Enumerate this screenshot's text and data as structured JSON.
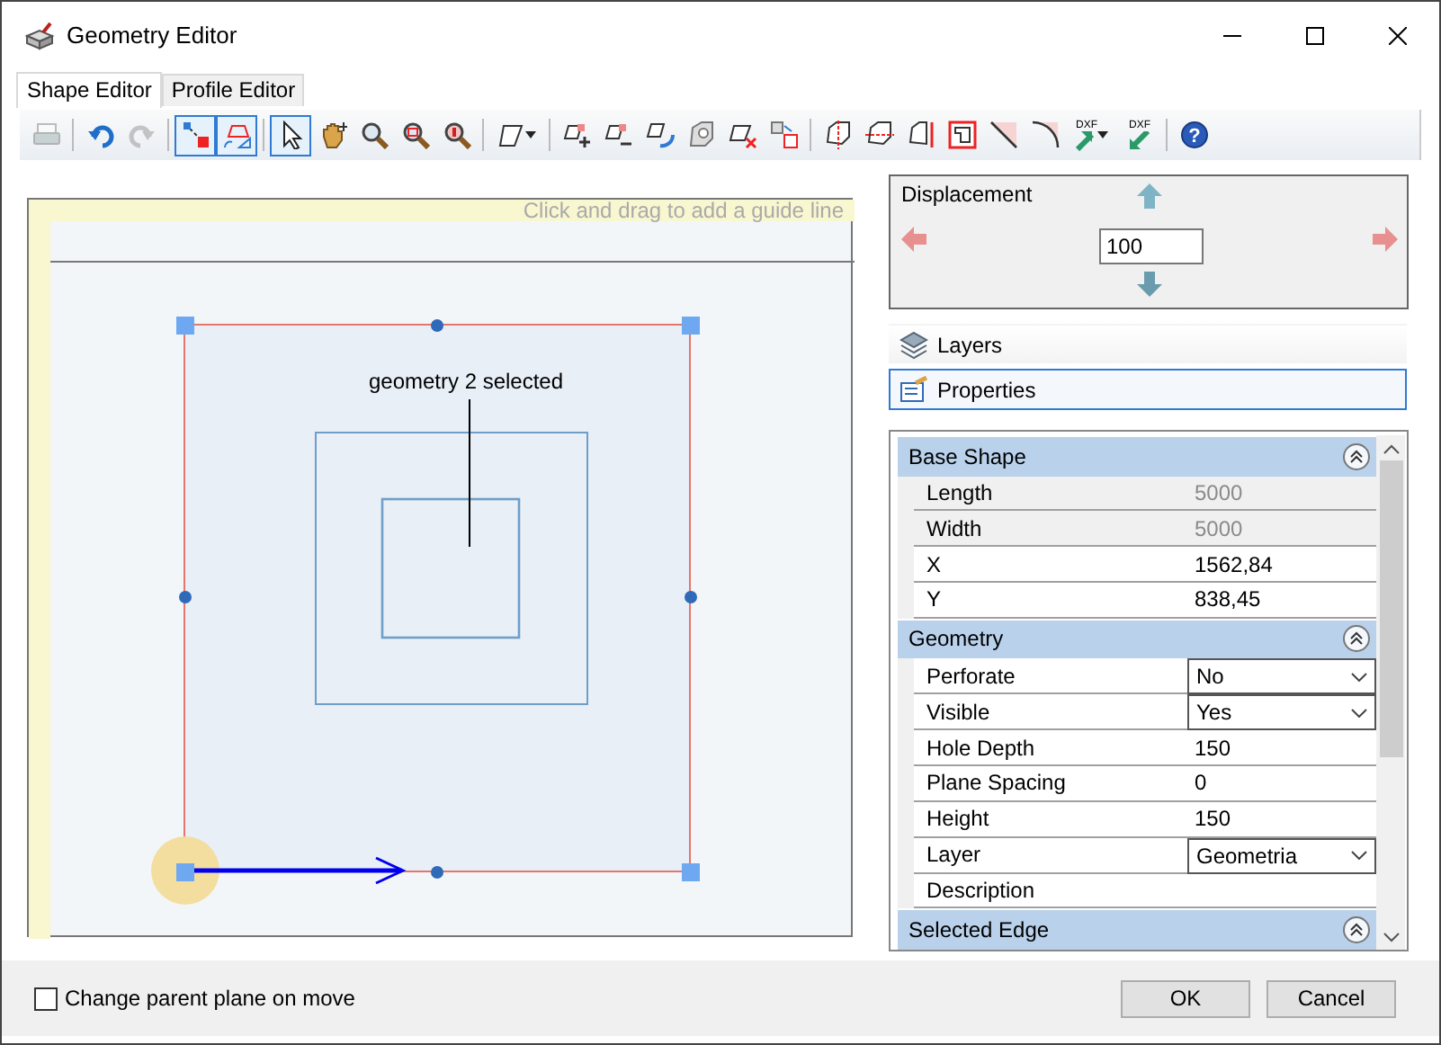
{
  "window": {
    "title": "Geometry Editor"
  },
  "tabs": [
    {
      "label": "Shape Editor",
      "selected": true
    },
    {
      "label": "Profile Editor",
      "selected": false
    }
  ],
  "toolbar": [
    [
      {
        "kind": "print",
        "selected": false,
        "disabled": true,
        "dropdown": false
      }
    ],
    [
      {
        "kind": "undo",
        "selected": false,
        "disabled": false,
        "dropdown": false
      },
      {
        "kind": "redo",
        "selected": false,
        "disabled": true,
        "dropdown": false
      }
    ],
    [
      {
        "kind": "node-edit",
        "selected": true,
        "disabled": false,
        "dropdown": false
      },
      {
        "kind": "shape-edit",
        "selected": true,
        "disabled": false,
        "dropdown": false
      }
    ],
    [
      {
        "kind": "pointer",
        "selected": true,
        "disabled": false,
        "dropdown": false
      },
      {
        "kind": "pan",
        "selected": false,
        "disabled": false,
        "dropdown": false
      },
      {
        "kind": "zoom",
        "selected": false,
        "disabled": false,
        "dropdown": false
      },
      {
        "kind": "zoom-box",
        "selected": false,
        "disabled": false,
        "dropdown": false
      },
      {
        "kind": "zoom-fit",
        "selected": false,
        "disabled": false,
        "dropdown": false
      }
    ],
    [
      {
        "kind": "polygon",
        "selected": false,
        "disabled": false,
        "dropdown": true
      }
    ],
    [
      {
        "kind": "add-node",
        "selected": false,
        "disabled": false,
        "dropdown": false
      },
      {
        "kind": "remove-node",
        "selected": false,
        "disabled": false,
        "dropdown": false
      },
      {
        "kind": "rotate",
        "selected": false,
        "disabled": false,
        "dropdown": false
      },
      {
        "kind": "shape",
        "selected": false,
        "disabled": false,
        "dropdown": false
      },
      {
        "kind": "delete-shape",
        "selected": false,
        "disabled": false,
        "dropdown": false
      },
      {
        "kind": "move",
        "selected": false,
        "disabled": false,
        "dropdown": false
      }
    ],
    [
      {
        "kind": "split-v",
        "selected": false,
        "disabled": false,
        "dropdown": false
      },
      {
        "kind": "split-h",
        "selected": false,
        "disabled": false,
        "dropdown": false
      },
      {
        "kind": "edge",
        "selected": false,
        "disabled": false,
        "dropdown": false
      },
      {
        "kind": "frame",
        "selected": false,
        "disabled": false,
        "dropdown": false
      },
      {
        "kind": "chamfer",
        "selected": false,
        "disabled": false,
        "dropdown": false
      },
      {
        "kind": "fillet",
        "selected": false,
        "disabled": false,
        "dropdown": false
      },
      {
        "kind": "dxf-import",
        "label": "DXF",
        "selected": false,
        "disabled": false,
        "dropdown": true
      },
      {
        "kind": "dxf-export",
        "label": "DXF",
        "selected": false,
        "disabled": false,
        "dropdown": false
      }
    ],
    [
      {
        "kind": "help",
        "label": "?",
        "selected": false,
        "disabled": false,
        "dropdown": false
      }
    ]
  ],
  "canvas": {
    "hint": "Click and drag to add a guide line",
    "label": "geometry 2 selected"
  },
  "displacement": {
    "title": "Displacement",
    "value": "100"
  },
  "panels": [
    {
      "label": "Layers",
      "selected": false
    },
    {
      "label": "Properties",
      "selected": true
    }
  ],
  "property_groups": [
    {
      "title": "Base Shape",
      "rows": [
        {
          "label": "Length",
          "value": "5000",
          "readonly": true,
          "kind": "text"
        },
        {
          "label": "Width",
          "value": "5000",
          "readonly": true,
          "kind": "text"
        },
        {
          "label": "X",
          "value": "1562,84",
          "readonly": false,
          "kind": "text"
        },
        {
          "label": "Y",
          "value": "838,45",
          "readonly": false,
          "kind": "text"
        }
      ]
    },
    {
      "title": "Geometry",
      "rows": [
        {
          "label": "Perforate",
          "value": "No",
          "readonly": false,
          "kind": "select"
        },
        {
          "label": "Visible",
          "value": "Yes",
          "readonly": false,
          "kind": "select"
        },
        {
          "label": "Hole Depth",
          "value": "150",
          "readonly": false,
          "kind": "text"
        },
        {
          "label": "Plane Spacing",
          "value": "0",
          "readonly": false,
          "kind": "text"
        },
        {
          "label": "Height",
          "value": "150",
          "readonly": false,
          "kind": "text"
        },
        {
          "label": "Layer",
          "value": "Geometria",
          "readonly": false,
          "kind": "select"
        },
        {
          "label": "Description",
          "readonly": false,
          "kind": "text"
        }
      ]
    },
    {
      "title": "Selected Edge"
    }
  ],
  "footer": {
    "checkbox": {
      "label": "Change parent plane on move",
      "checked": false
    },
    "buttons": [
      "OK",
      "Cancel"
    ]
  }
}
